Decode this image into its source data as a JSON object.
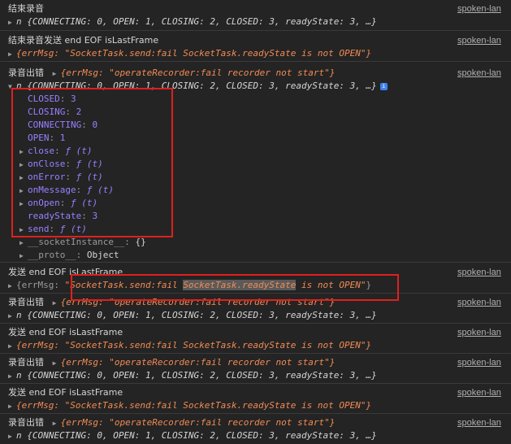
{
  "source_link": "spoken-lan",
  "entries": [
    {
      "message": "结束录音",
      "object": "n {CONNECTING: 0, OPEN: 1, CLOSING: 2, CLOSED: 3, readyState: 3, …}"
    },
    {
      "message": "结束录音发送 end EOF isLastFrame",
      "object": "{errMsg: \"SocketTask.send:fail SocketTask.readyState is not OPEN\"}"
    },
    {
      "message": "录音出错",
      "inline": "{errMsg: \"operateRecorder:fail recorder not start\"}",
      "object": "n {CONNECTING: 0, OPEN: 1, CLOSING: 2, CLOSED: 3, readyState: 3, …}",
      "badge": "i",
      "props": [
        {
          "key": "CLOSED",
          "value": "3"
        },
        {
          "key": "CLOSING",
          "value": "2"
        },
        {
          "key": "CONNECTING",
          "value": "0"
        },
        {
          "key": "OPEN",
          "value": "1"
        },
        {
          "key": "close",
          "value": "ƒ (t)"
        },
        {
          "key": "onClose",
          "value": "ƒ (t)"
        },
        {
          "key": "onError",
          "value": "ƒ (t)"
        },
        {
          "key": "onMessage",
          "value": "ƒ (t)"
        },
        {
          "key": "onOpen",
          "value": "ƒ (t)"
        },
        {
          "key": "readyState",
          "value": "3"
        },
        {
          "key": "send",
          "value": "ƒ (t)"
        }
      ],
      "extra": [
        {
          "key": "__socketInstance__",
          "value": "{}"
        },
        {
          "key": "__proto__",
          "value": "Object"
        }
      ]
    },
    {
      "message": "发送 end EOF isLastFrame",
      "object": "{errMsg: \"SocketTask.send:fail SocketTask.readyState is not OPEN\"}",
      "highlight": "SocketTask.readyState"
    },
    {
      "message": "录音出错",
      "inline": "{errMsg: \"operateRecorder:fail recorder not start\"}",
      "object": "n {CONNECTING: 0, OPEN: 1, CLOSING: 2, CLOSED: 3, readyState: 3, …}"
    },
    {
      "message": "发送 end EOF isLastFrame",
      "object": "{errMsg: \"SocketTask.send:fail SocketTask.readyState is not OPEN\"}"
    },
    {
      "message": "录音出错",
      "inline": "{errMsg: \"operateRecorder:fail recorder not start\"}",
      "object": "n {CONNECTING: 0, OPEN: 1, CLOSING: 2, CLOSED: 3, readyState: 3, …}"
    },
    {
      "message": "发送 end EOF isLastFrame",
      "object": "{errMsg: \"SocketTask.send:fail SocketTask.readyState is not OPEN\"}"
    },
    {
      "message": "录音出错",
      "inline": "{errMsg: \"operateRecorder:fail recorder not start\"}",
      "object": "n {CONNECTING: 0, OPEN: 1, CLOSING: 2, CLOSED: 3, readyState: 3, …}"
    }
  ],
  "colors": {
    "background": "#242424",
    "annotation": "#e0201c",
    "string": "#f28b54",
    "number": "#9980ff"
  },
  "icons": {
    "expand": "triangle-right-icon",
    "expanded": "triangle-down-icon",
    "info": "info-badge-icon"
  }
}
